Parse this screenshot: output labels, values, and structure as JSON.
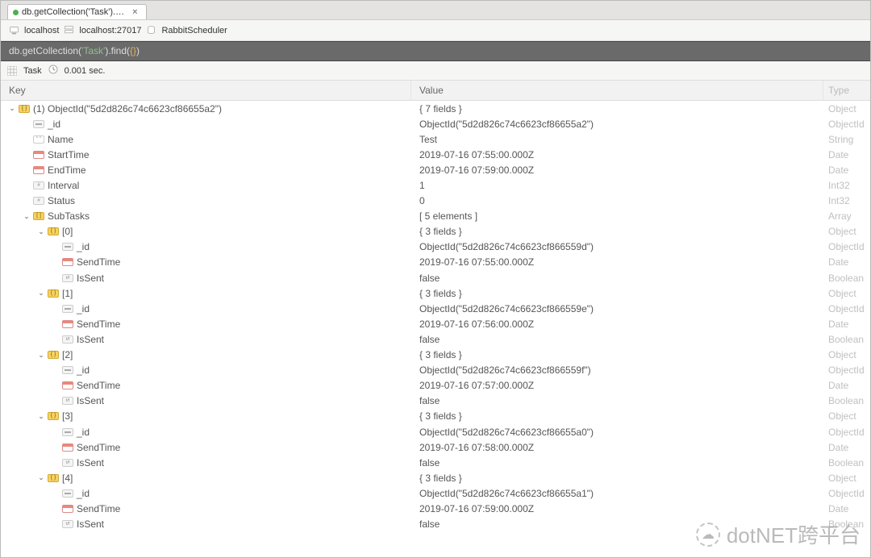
{
  "tab": {
    "title": "db.getCollection('Task').…"
  },
  "breadcrumb": {
    "host": "localhost",
    "hostport": "localhost:27017",
    "db": "RabbitScheduler"
  },
  "query": {
    "prefix": "db.getCollection(",
    "str": "'Task'",
    "mid": ").find(",
    "braces": "{}",
    "suffix": ")"
  },
  "status": {
    "collection": "Task",
    "timing": "0.001 sec."
  },
  "columns": {
    "key": "Key",
    "value": "Value",
    "type": "Type"
  },
  "watermark": "dotNET跨平台",
  "tree": [
    {
      "depth": 0,
      "exp": "open",
      "icon": "obj",
      "key": "(1) ObjectId(\"5d2d826c74c6623cf86655a2\")",
      "value": "{ 7 fields }",
      "type": "Object"
    },
    {
      "depth": 1,
      "exp": "",
      "icon": "objid",
      "key": "_id",
      "value": "ObjectId(\"5d2d826c74c6623cf86655a2\")",
      "type": "ObjectId"
    },
    {
      "depth": 1,
      "exp": "",
      "icon": "str",
      "key": "Name",
      "value": "Test",
      "type": "String"
    },
    {
      "depth": 1,
      "exp": "",
      "icon": "date",
      "key": "StartTime",
      "value": "2019-07-16 07:55:00.000Z",
      "type": "Date"
    },
    {
      "depth": 1,
      "exp": "",
      "icon": "date",
      "key": "EndTime",
      "value": "2019-07-16 07:59:00.000Z",
      "type": "Date"
    },
    {
      "depth": 1,
      "exp": "",
      "icon": "int",
      "key": "Interval",
      "value": "1",
      "type": "Int32"
    },
    {
      "depth": 1,
      "exp": "",
      "icon": "int",
      "key": "Status",
      "value": "0",
      "type": "Int32"
    },
    {
      "depth": 1,
      "exp": "open",
      "icon": "arr",
      "key": "SubTasks",
      "value": "[ 5 elements ]",
      "type": "Array"
    },
    {
      "depth": 2,
      "exp": "open",
      "icon": "obj",
      "key": "[0]",
      "value": "{ 3 fields }",
      "type": "Object"
    },
    {
      "depth": 3,
      "exp": "",
      "icon": "objid",
      "key": "_id",
      "value": "ObjectId(\"5d2d826c74c6623cf866559d\")",
      "type": "ObjectId"
    },
    {
      "depth": 3,
      "exp": "",
      "icon": "date",
      "key": "SendTime",
      "value": "2019-07-16 07:55:00.000Z",
      "type": "Date"
    },
    {
      "depth": 3,
      "exp": "",
      "icon": "bool",
      "key": "IsSent",
      "value": "false",
      "type": "Boolean"
    },
    {
      "depth": 2,
      "exp": "open",
      "icon": "obj",
      "key": "[1]",
      "value": "{ 3 fields }",
      "type": "Object"
    },
    {
      "depth": 3,
      "exp": "",
      "icon": "objid",
      "key": "_id",
      "value": "ObjectId(\"5d2d826c74c6623cf866559e\")",
      "type": "ObjectId"
    },
    {
      "depth": 3,
      "exp": "",
      "icon": "date",
      "key": "SendTime",
      "value": "2019-07-16 07:56:00.000Z",
      "type": "Date"
    },
    {
      "depth": 3,
      "exp": "",
      "icon": "bool",
      "key": "IsSent",
      "value": "false",
      "type": "Boolean"
    },
    {
      "depth": 2,
      "exp": "open",
      "icon": "obj",
      "key": "[2]",
      "value": "{ 3 fields }",
      "type": "Object"
    },
    {
      "depth": 3,
      "exp": "",
      "icon": "objid",
      "key": "_id",
      "value": "ObjectId(\"5d2d826c74c6623cf866559f\")",
      "type": "ObjectId"
    },
    {
      "depth": 3,
      "exp": "",
      "icon": "date",
      "key": "SendTime",
      "value": "2019-07-16 07:57:00.000Z",
      "type": "Date"
    },
    {
      "depth": 3,
      "exp": "",
      "icon": "bool",
      "key": "IsSent",
      "value": "false",
      "type": "Boolean"
    },
    {
      "depth": 2,
      "exp": "open",
      "icon": "obj",
      "key": "[3]",
      "value": "{ 3 fields }",
      "type": "Object"
    },
    {
      "depth": 3,
      "exp": "",
      "icon": "objid",
      "key": "_id",
      "value": "ObjectId(\"5d2d826c74c6623cf86655a0\")",
      "type": "ObjectId"
    },
    {
      "depth": 3,
      "exp": "",
      "icon": "date",
      "key": "SendTime",
      "value": "2019-07-16 07:58:00.000Z",
      "type": "Date"
    },
    {
      "depth": 3,
      "exp": "",
      "icon": "bool",
      "key": "IsSent",
      "value": "false",
      "type": "Boolean"
    },
    {
      "depth": 2,
      "exp": "open",
      "icon": "obj",
      "key": "[4]",
      "value": "{ 3 fields }",
      "type": "Object"
    },
    {
      "depth": 3,
      "exp": "",
      "icon": "objid",
      "key": "_id",
      "value": "ObjectId(\"5d2d826c74c6623cf86655a1\")",
      "type": "ObjectId"
    },
    {
      "depth": 3,
      "exp": "",
      "icon": "date",
      "key": "SendTime",
      "value": "2019-07-16 07:59:00.000Z",
      "type": "Date"
    },
    {
      "depth": 3,
      "exp": "",
      "icon": "bool",
      "key": "IsSent",
      "value": "false",
      "type": "Boolean"
    }
  ]
}
